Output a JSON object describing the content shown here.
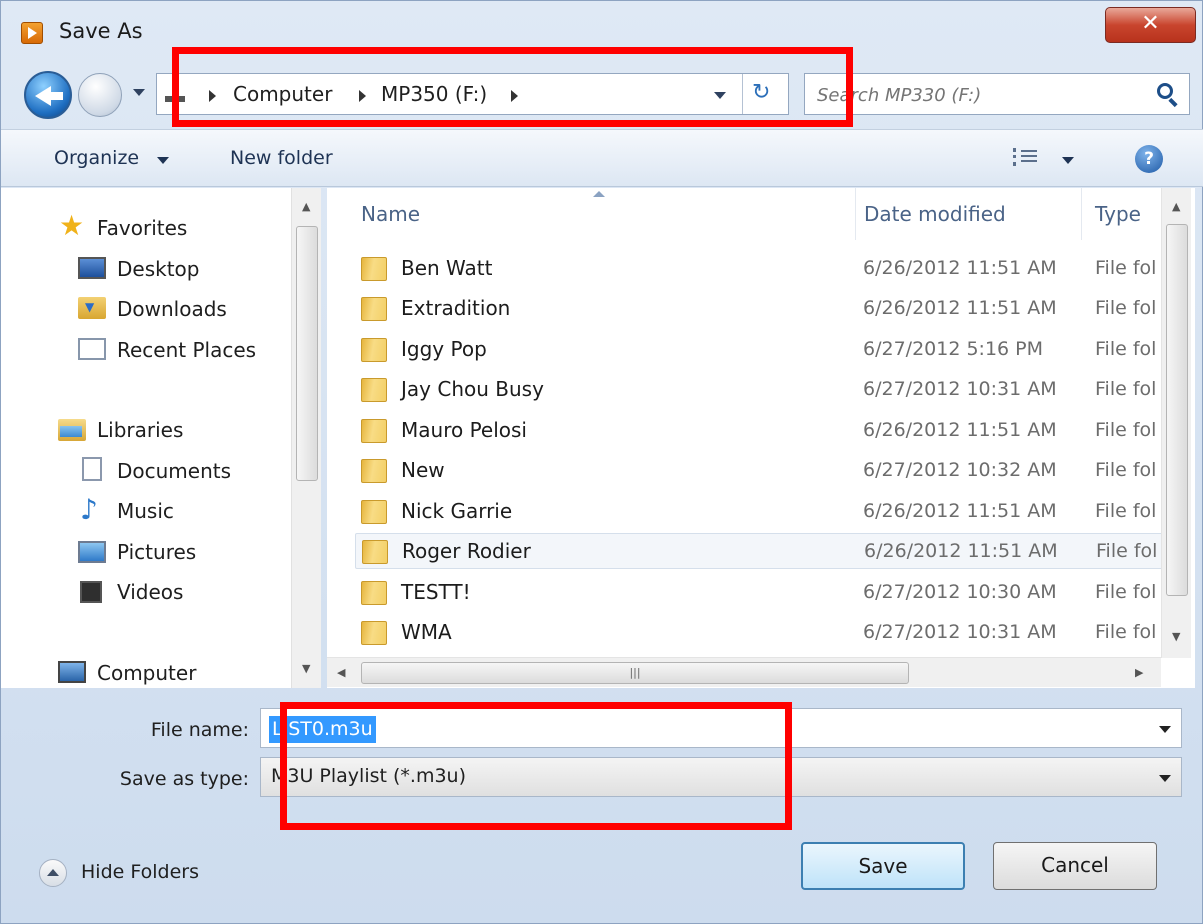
{
  "window": {
    "title": "Save As",
    "close_label": "✕"
  },
  "address": {
    "crumbs": [
      "Computer",
      "MP350 (F:)"
    ],
    "search_placeholder": "Search MP330 (F:)"
  },
  "toolbar": {
    "organize_label": "Organize",
    "new_folder_label": "New folder",
    "help_label": "?"
  },
  "nav_pane": {
    "favorites": {
      "label": "Favorites",
      "items": [
        "Desktop",
        "Downloads",
        "Recent Places"
      ]
    },
    "libraries": {
      "label": "Libraries",
      "items": [
        "Documents",
        "Music",
        "Pictures",
        "Videos"
      ]
    },
    "computer": "Computer"
  },
  "file_list": {
    "columns": [
      "Name",
      "Date modified",
      "Type"
    ],
    "rows": [
      {
        "name": "Ben Watt",
        "date": "6/26/2012 11:51 AM",
        "type": "File fol"
      },
      {
        "name": "Extradition",
        "date": "6/26/2012 11:51 AM",
        "type": "File fol"
      },
      {
        "name": "Iggy Pop",
        "date": "6/27/2012 5:16 PM",
        "type": "File fol"
      },
      {
        "name": "Jay Chou Busy",
        "date": "6/27/2012 10:31 AM",
        "type": "File fol"
      },
      {
        "name": "Mauro Pelosi",
        "date": "6/26/2012 11:51 AM",
        "type": "File fol"
      },
      {
        "name": "New",
        "date": "6/27/2012 10:32 AM",
        "type": "File fol"
      },
      {
        "name": "Nick Garrie",
        "date": "6/26/2012 11:51 AM",
        "type": "File fol"
      },
      {
        "name": "Roger Rodier",
        "date": "6/26/2012 11:51 AM",
        "type": "File fol"
      },
      {
        "name": "TESTT!",
        "date": "6/27/2012 10:30 AM",
        "type": "File fol"
      },
      {
        "name": "WMA",
        "date": "6/27/2012 10:31 AM",
        "type": "File fol"
      }
    ],
    "selected_row": "Roger Rodier"
  },
  "form": {
    "file_name_label": "File name:",
    "file_name_value": "LIST0.m3u",
    "save_type_label": "Save as type:",
    "save_type_value": "M3U Playlist (*.m3u)"
  },
  "footer": {
    "hide_folders_label": "Hide Folders",
    "save_label": "Save",
    "cancel_label": "Cancel"
  },
  "colors": {
    "highlight_box": "#ff0000",
    "selection": "#3399ff",
    "accent": "#1e5aa6"
  }
}
